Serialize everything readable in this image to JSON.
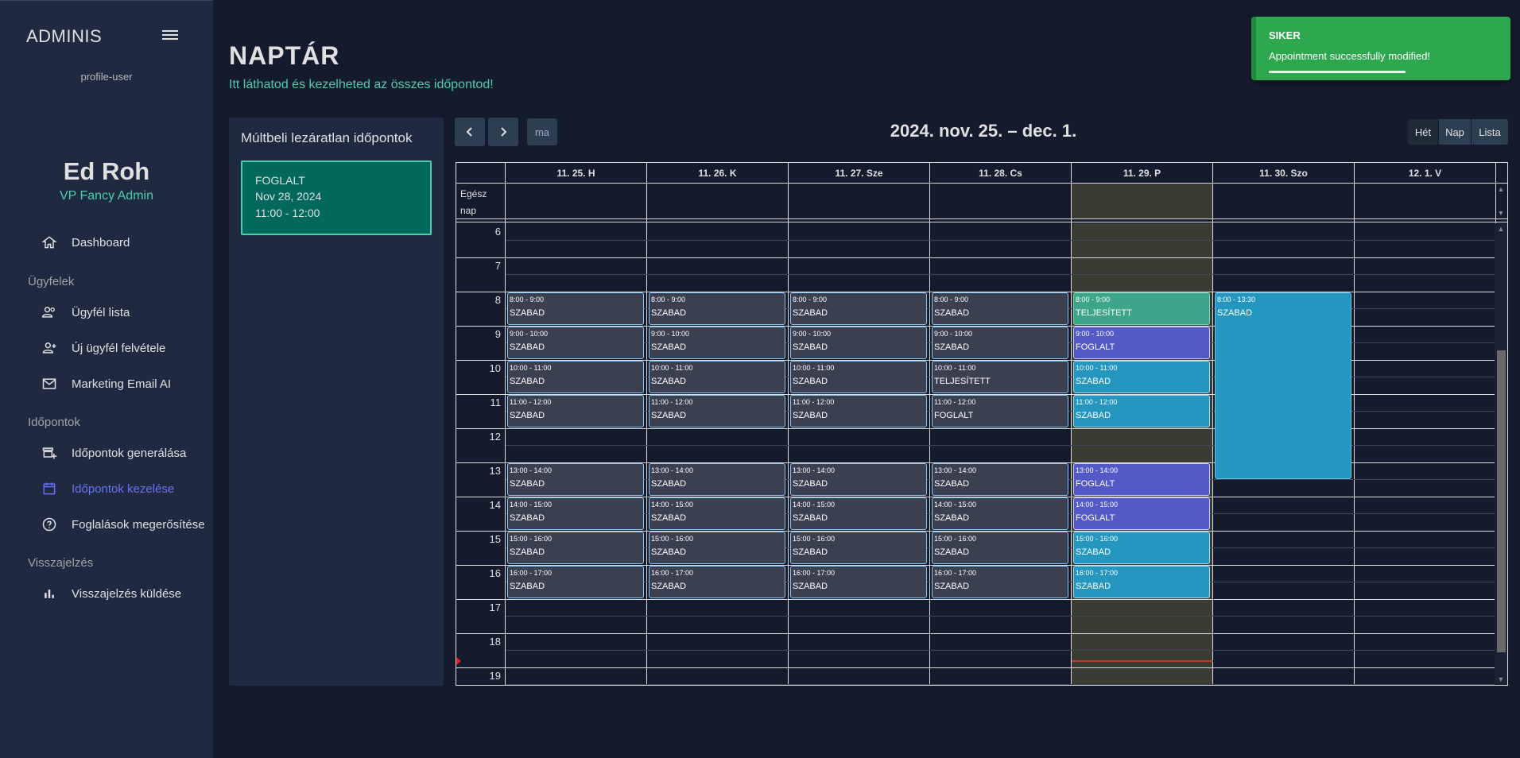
{
  "app": {
    "brand": "ADMINIS"
  },
  "sidebar": {
    "profile_alt": "profile-user",
    "user_name": "Ed Roh",
    "user_role": "VP Fancy Admin",
    "dashboard": "Dashboard",
    "sections": {
      "clients": "Ügyfelek",
      "appointments": "Időpontok",
      "feedback": "Visszajelzés"
    },
    "items": {
      "client_list": "Ügyfél lista",
      "new_client": "Új ügyfél felvétele",
      "marketing": "Marketing Email AI",
      "generate": "Időpontok generálása",
      "manage": "Időpontok kezelése",
      "confirm": "Foglalások megerősítése",
      "send_feedback": "Visszajelzés küldése"
    }
  },
  "header": {
    "title": "NAPTÁR",
    "subtitle": "Itt láthatod és kezelheted az összes időpontod!"
  },
  "toast": {
    "title": "SIKER",
    "message": "Appointment successfully modified!"
  },
  "past_panel": {
    "title": "Múltbeli lezáratlan időpontok",
    "card": {
      "status": "FOGLALT",
      "date": "Nov 28, 2024",
      "time": "11:00 - 12:00"
    }
  },
  "calendar": {
    "title": "2024. nov. 25. – dec. 1.",
    "today_label": "ma",
    "view_week": "Hét",
    "view_day": "Nap",
    "view_list": "Lista",
    "allday_label": "Egész nap",
    "days": [
      "11. 25. H",
      "11. 26. K",
      "11. 27. Sze",
      "11. 28. Cs",
      "11. 29. P",
      "11. 30. Szo",
      "12. 1. V"
    ],
    "hours": [
      "6",
      "7",
      "8",
      "9",
      "10",
      "11",
      "12",
      "13",
      "14",
      "15",
      "16",
      "17",
      "18",
      "19"
    ],
    "status_szabad": "SZABAD",
    "status_foglalt": "FOGLALT",
    "status_teljesitett": "TELJESÍTETT",
    "times": {
      "t8": "8:00 - 9:00",
      "t9": "9:00 - 10:00",
      "t10": "10:00 - 11:00",
      "t11": "11:00 - 12:00",
      "t13": "13:00 - 14:00",
      "t14": "14:00 - 15:00",
      "t15": "15:00 - 16:00",
      "t16": "16:00 - 17:00",
      "sat": "8:00 - 13:30"
    }
  },
  "colors": {
    "accent": "#4cceac",
    "active_nav": "#6870fa",
    "toast_bg": "#2ea84f",
    "foglalt": "#535ac8",
    "teljesitett": "#3da58a",
    "szabad_today": "#2596be"
  }
}
